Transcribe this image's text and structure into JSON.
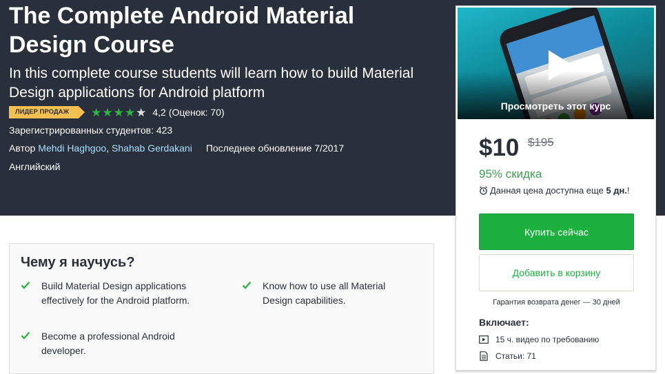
{
  "course": {
    "title": "The Complete Android Material Design Course",
    "subtitle": "In this complete course students will learn how to build Material Design applications for Android platform",
    "badge": "ЛИДЕР ПРОДАЖ",
    "rating_value": "4,2",
    "rating_count": "(Оценок: 70)",
    "rating_stars": 4.2,
    "students": "Зарегистрированных студентов: 423",
    "author_label": "Автор",
    "authors": [
      "Mehdi Haghgoo",
      "Shahab Gerdakani"
    ],
    "author_separator": ",",
    "last_updated": "Последнее обновление 7/2017",
    "language": "Английский"
  },
  "sidebar": {
    "preview_label": "Просмотреть этот курс",
    "price": "$10",
    "original_price": "$195",
    "discount": "95% скидка",
    "deadline_text": "Данная цена доступна еще",
    "deadline_days": "5 дн.",
    "deadline_end": "!",
    "buy_label": "Купить сейчас",
    "cart_label": "Добавить в корзину",
    "guarantee": "Гарантия возврата денег — 30 дней",
    "includes_title": "Включает:",
    "includes": [
      {
        "icon": "video-icon",
        "text": "15 ч. видео по требованию"
      },
      {
        "icon": "article-icon",
        "text": "Статьи: 71"
      }
    ]
  },
  "learn": {
    "title": "Чему я научусь?",
    "items": [
      "Build Material Design applications effectively for the Android platform.",
      "Know how to use all Material Design capabilities.",
      "Become a professional Android developer."
    ]
  },
  "colors": {
    "hero_bg": "#29303b",
    "accent_green": "#1cb03f",
    "link_blue": "#a6dfff",
    "badge_yellow": "#f4c150",
    "discount_green": "#3d9e4e"
  }
}
